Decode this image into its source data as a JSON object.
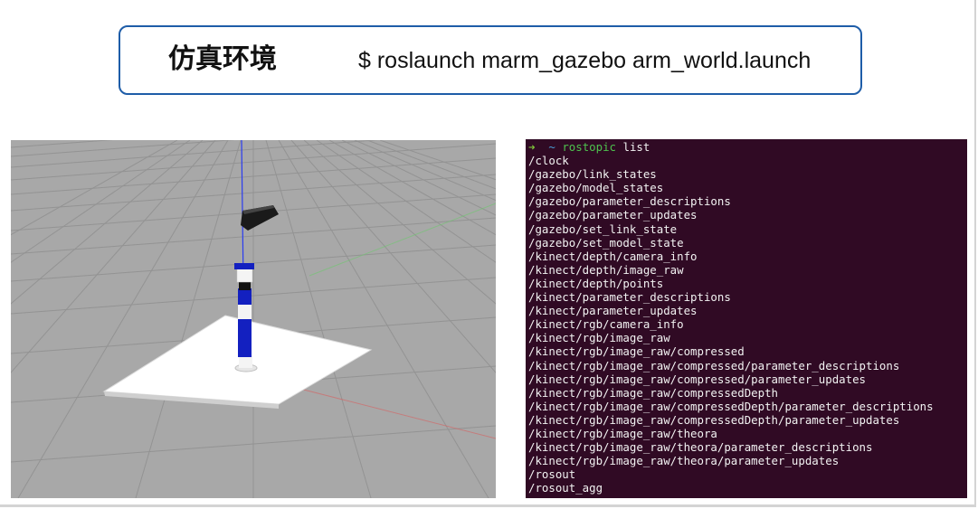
{
  "header": {
    "title": "仿真环境",
    "command": "$ roslaunch marm_gazebo arm_world.launch"
  },
  "viewport": {
    "label": "gazebo-3d-view",
    "background_color": "#a8a8a8",
    "grid_color": "#8e8e8e",
    "base_plate_color": "#ffffff",
    "arm_blue": "#1320c0",
    "axis_blue": "#2a3cf0"
  },
  "terminal": {
    "background_color": "#300a24",
    "prompt": {
      "arrow": "➜",
      "tilde": "~",
      "command": "rostopic",
      "args": "list"
    },
    "topics": [
      "/clock",
      "/gazebo/link_states",
      "/gazebo/model_states",
      "/gazebo/parameter_descriptions",
      "/gazebo/parameter_updates",
      "/gazebo/set_link_state",
      "/gazebo/set_model_state",
      "/kinect/depth/camera_info",
      "/kinect/depth/image_raw",
      "/kinect/depth/points",
      "/kinect/parameter_descriptions",
      "/kinect/parameter_updates",
      "/kinect/rgb/camera_info",
      "/kinect/rgb/image_raw",
      "/kinect/rgb/image_raw/compressed",
      "/kinect/rgb/image_raw/compressed/parameter_descriptions",
      "/kinect/rgb/image_raw/compressed/parameter_updates",
      "/kinect/rgb/image_raw/compressedDepth",
      "/kinect/rgb/image_raw/compressedDepth/parameter_descriptions",
      "/kinect/rgb/image_raw/compressedDepth/parameter_updates",
      "/kinect/rgb/image_raw/theora",
      "/kinect/rgb/image_raw/theora/parameter_descriptions",
      "/kinect/rgb/image_raw/theora/parameter_updates",
      "/rosout",
      "/rosout_agg"
    ]
  }
}
